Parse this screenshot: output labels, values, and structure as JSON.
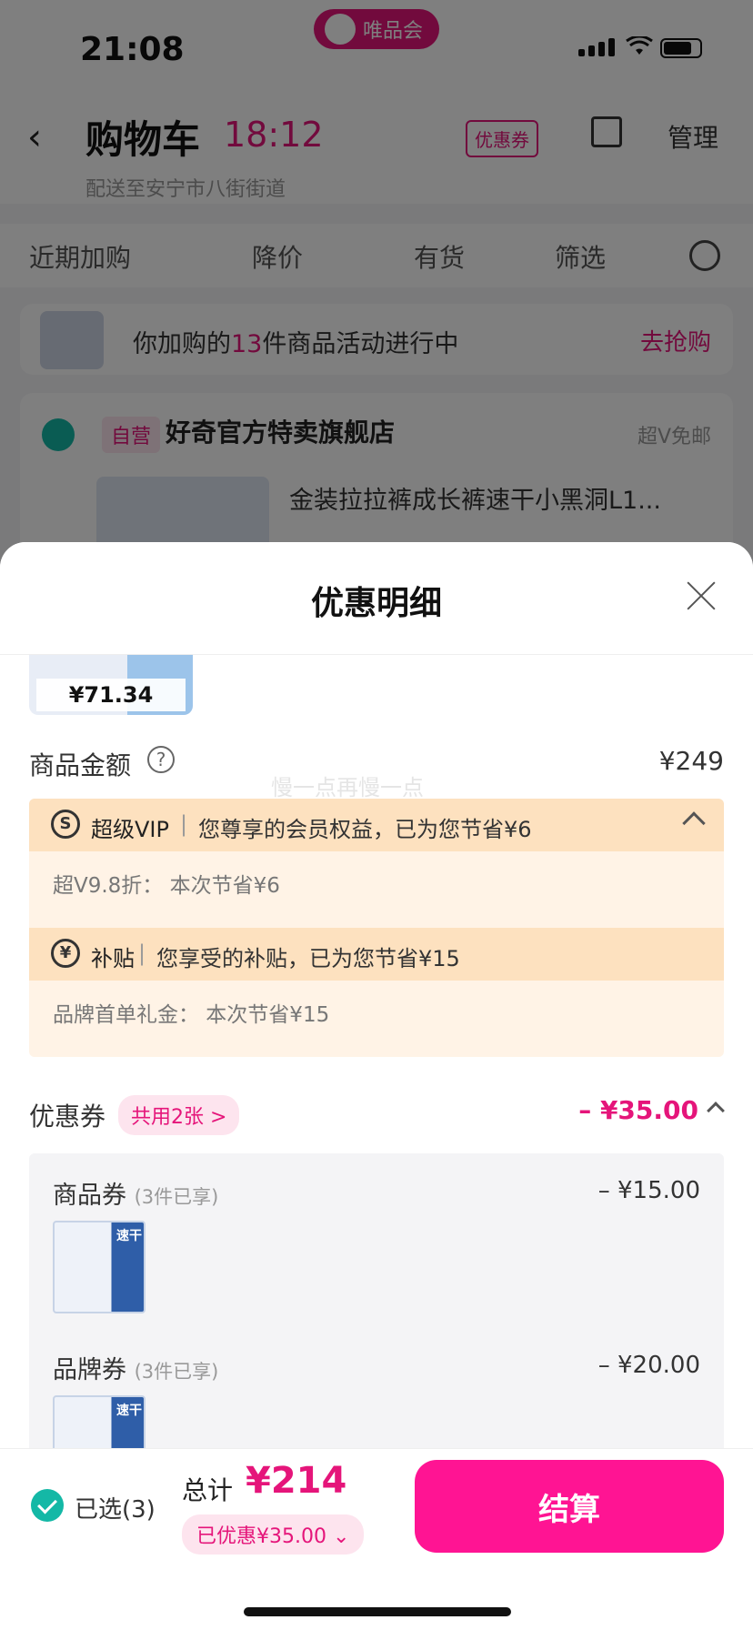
{
  "status_bar": {
    "time": "21:08",
    "app_badge": "唯品会"
  },
  "header": {
    "title": "购物车",
    "timer": "18:12",
    "coupon_tag": "优惠券",
    "manage": "管理",
    "delivery": "配送至安宁市八街街道"
  },
  "filters": [
    "近期加购",
    "降价",
    "有货",
    "筛选"
  ],
  "promo": {
    "prefix": "你加购的",
    "count": "13",
    "suffix": "件商品活动进行中",
    "action": "去抢购"
  },
  "store": {
    "self_badge": "自营",
    "name": "好奇官方特卖旗舰店",
    "shipping": "超V免邮",
    "product_title": "金装拉拉裤成长裤速干小黑洞L1..."
  },
  "sheet": {
    "title": "优惠明细",
    "prev_item_price": "¥71.34",
    "amount_label": "商品金额",
    "amount_value": "¥249",
    "watermark": "慢一点再慢一点",
    "vip": {
      "icon": "S",
      "name": "超级VIP",
      "desc": "您尊享的会员权益，已为您节省¥6",
      "detail": "超V9.8折： 本次节省¥6"
    },
    "subsidy": {
      "icon": "¥",
      "name": "补贴",
      "desc": "您享受的补贴，已为您节省¥15",
      "detail": "品牌首单礼金： 本次节省¥15"
    },
    "coupons": {
      "label": "优惠券",
      "shared": "共用2张 >",
      "total": "– ¥35.00",
      "items": [
        {
          "title": "商品券",
          "note": "(3件已享)",
          "amount": "– ¥15.00",
          "tag": "速干"
        },
        {
          "title": "品牌券",
          "note": "(3件已享)",
          "amount": "– ¥20.00",
          "tag": "速干"
        }
      ]
    }
  },
  "footer": {
    "selected": "已选(3)",
    "total_label": "总计",
    "total_value": "¥214",
    "saved": "已优惠¥35.00 ⌄",
    "checkout": "结算"
  },
  "colors": {
    "accent": "#e5157a",
    "checkout": "#ff1493",
    "check": "#14b8a6"
  }
}
